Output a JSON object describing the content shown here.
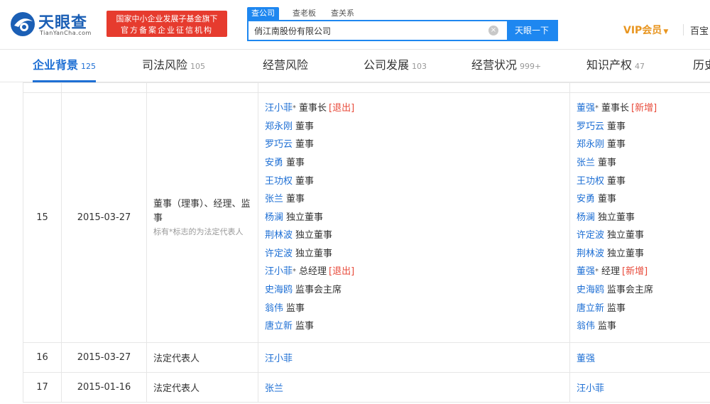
{
  "brand": {
    "title": "天眼查",
    "subtitle": "TianYanCha.com",
    "color": "#1b5fb5"
  },
  "badge": {
    "line1": "国家中小企业发展子基金旗下",
    "line2": "官方备案企业征信机构",
    "color": "#e63b2e"
  },
  "search": {
    "tabs": [
      {
        "label": "查公司",
        "active": true
      },
      {
        "label": "查老板",
        "active": false
      },
      {
        "label": "查关系",
        "active": false
      }
    ],
    "value": "俏江南股份有限公司",
    "button_label": "天眼一下",
    "accent": "#1e87f0"
  },
  "header_right": {
    "vip_label": "VIP会员",
    "more_label": "百宝"
  },
  "nav": [
    {
      "label": "企业背景",
      "count": "125",
      "active": true
    },
    {
      "label": "司法风险",
      "count": "105",
      "active": false
    },
    {
      "label": "经营风险",
      "count": "",
      "active": false
    },
    {
      "label": "公司发展",
      "count": "103",
      "active": false
    },
    {
      "label": "经营状况",
      "count": "999+",
      "active": false
    },
    {
      "label": "知识产权",
      "count": "47",
      "active": false
    },
    {
      "label": "历史",
      "count": "",
      "active": false
    }
  ],
  "rows": [
    {
      "no": "15",
      "date": "2015-03-27",
      "item_title": "董事（理事）、经理、监事",
      "item_note": "标有*标志的为法定代表人",
      "before": [
        {
          "name": "汪小菲",
          "legal": true,
          "role": "董事长",
          "tag": "[退出]"
        },
        {
          "name": "郑永刚",
          "legal": false,
          "role": "董事",
          "tag": ""
        },
        {
          "name": "罗巧云",
          "legal": false,
          "role": "董事",
          "tag": ""
        },
        {
          "name": "安勇",
          "legal": false,
          "role": "董事",
          "tag": ""
        },
        {
          "name": "王功权",
          "legal": false,
          "role": "董事",
          "tag": ""
        },
        {
          "name": "张兰",
          "legal": false,
          "role": "董事",
          "tag": ""
        },
        {
          "name": "杨澜",
          "legal": false,
          "role": "独立董事",
          "tag": ""
        },
        {
          "name": "荆林波",
          "legal": false,
          "role": "独立董事",
          "tag": ""
        },
        {
          "name": "许定波",
          "legal": false,
          "role": "独立董事",
          "tag": ""
        },
        {
          "name": "汪小菲",
          "legal": true,
          "role": "总经理",
          "tag": "[退出]"
        },
        {
          "name": "史海鸥",
          "legal": false,
          "role": "监事会主席",
          "tag": ""
        },
        {
          "name": "翁伟",
          "legal": false,
          "role": "监事",
          "tag": ""
        },
        {
          "name": "唐立新",
          "legal": false,
          "role": "监事",
          "tag": ""
        }
      ],
      "after": [
        {
          "name": "董强",
          "legal": true,
          "role": "董事长",
          "tag": "[新增]"
        },
        {
          "name": "罗巧云",
          "legal": false,
          "role": "董事",
          "tag": ""
        },
        {
          "name": "郑永刚",
          "legal": false,
          "role": "董事",
          "tag": ""
        },
        {
          "name": "张兰",
          "legal": false,
          "role": "董事",
          "tag": ""
        },
        {
          "name": "王功权",
          "legal": false,
          "role": "董事",
          "tag": ""
        },
        {
          "name": "安勇",
          "legal": false,
          "role": "董事",
          "tag": ""
        },
        {
          "name": "杨澜",
          "legal": false,
          "role": "独立董事",
          "tag": ""
        },
        {
          "name": "许定波",
          "legal": false,
          "role": "独立董事",
          "tag": ""
        },
        {
          "name": "荆林波",
          "legal": false,
          "role": "独立董事",
          "tag": ""
        },
        {
          "name": "董强",
          "legal": true,
          "role": "经理",
          "tag": "[新增]"
        },
        {
          "name": "史海鸥",
          "legal": false,
          "role": "监事会主席",
          "tag": ""
        },
        {
          "name": "唐立新",
          "legal": false,
          "role": "监事",
          "tag": ""
        },
        {
          "name": "翁伟",
          "legal": false,
          "role": "监事",
          "tag": ""
        }
      ]
    },
    {
      "no": "16",
      "date": "2015-03-27",
      "item_title": "法定代表人",
      "item_note": "",
      "before": [
        {
          "name": "汪小菲",
          "legal": false,
          "role": "",
          "tag": ""
        }
      ],
      "after": [
        {
          "name": "董强",
          "legal": false,
          "role": "",
          "tag": ""
        }
      ]
    },
    {
      "no": "17",
      "date": "2015-01-16",
      "item_title": "法定代表人",
      "item_note": "",
      "before": [
        {
          "name": "张兰",
          "legal": false,
          "role": "",
          "tag": ""
        }
      ],
      "after": [
        {
          "name": "汪小菲",
          "legal": false,
          "role": "",
          "tag": ""
        }
      ]
    }
  ]
}
